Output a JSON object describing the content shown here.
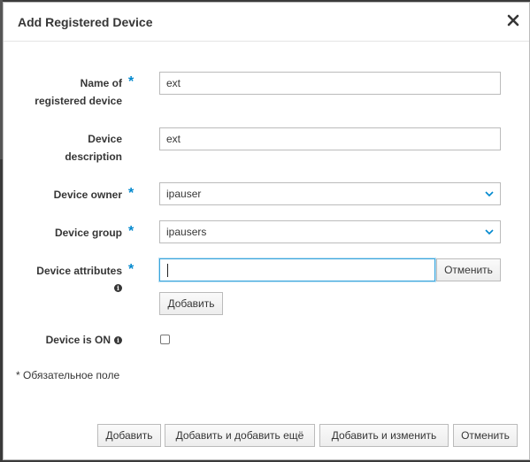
{
  "dialog": {
    "title": "Add Registered Device"
  },
  "fields": {
    "name": {
      "label_line1": "Name of",
      "label_line2": "registered device",
      "value": "ext"
    },
    "description": {
      "label_line1": "Device",
      "label_line2": "description",
      "value": "ext"
    },
    "owner": {
      "label": "Device owner",
      "value": "ipauser"
    },
    "group": {
      "label": "Device group",
      "value": "ipausers"
    },
    "attributes": {
      "label": "Device attributes",
      "value": "",
      "cancel_label": "Отменить",
      "add_label": "Добавить"
    },
    "is_on": {
      "label": "Device is ON",
      "checked": false
    }
  },
  "required_marker": "*",
  "required_note": "* Обязательное поле",
  "footer": {
    "add": "Добавить",
    "add_another": "Добавить и добавить ещё",
    "add_and_edit": "Добавить и изменить",
    "cancel": "Отменить"
  },
  "icons": {
    "close": "close-icon",
    "info": "info-icon",
    "chevron": "chevron-down-icon"
  },
  "colors": {
    "accent": "#0088ce",
    "focus_border": "#39a5dc"
  }
}
